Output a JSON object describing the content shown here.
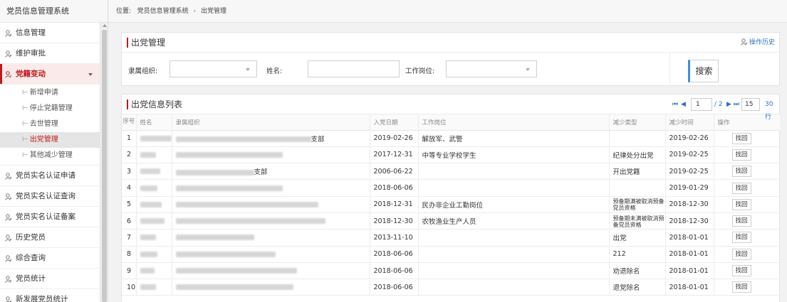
{
  "app": {
    "title": "党员信息管理系统"
  },
  "breadcrumb": {
    "label": "位置:",
    "path": [
      "党员信息管理系统",
      "出党管理"
    ],
    "separator": "›"
  },
  "sidebar": {
    "items": [
      {
        "label": "信息管理",
        "icon": "user-icon"
      },
      {
        "label": "维护审批",
        "icon": "user-icon"
      },
      {
        "label": "党籍变动",
        "icon": "user-icon",
        "active": true,
        "children": [
          {
            "label": "新增申请"
          },
          {
            "label": "停止党籍管理"
          },
          {
            "label": "去世管理"
          },
          {
            "label": "出党管理",
            "selected": true
          },
          {
            "label": "其他减少管理"
          }
        ]
      },
      {
        "label": "党员实名认证申请",
        "icon": "user-icon"
      },
      {
        "label": "党员实名认证查询",
        "icon": "user-icon"
      },
      {
        "label": "党员实名认证备案",
        "icon": "user-icon"
      },
      {
        "label": "历史党员",
        "icon": "user-icon"
      },
      {
        "label": "综合查询",
        "icon": "user-icon"
      },
      {
        "label": "党员统计",
        "icon": "user-icon"
      },
      {
        "label": "新发展党员统计",
        "icon": "user-icon"
      }
    ]
  },
  "filter_panel": {
    "title": "出党管理",
    "history_link": "操作历史",
    "org_label": "隶属组织:",
    "name_label": "姓名:",
    "post_label": "工作岗位:",
    "org_value": "",
    "name_value": "",
    "post_value": "",
    "search_button": "搜索"
  },
  "list_panel": {
    "title": "出党信息列表",
    "pager": {
      "first": "⏮",
      "prev": "◀",
      "current": "1",
      "total": "/ 2",
      "next": "▶",
      "last": "⏭",
      "page_size": "15",
      "count": "30行"
    },
    "columns": [
      "序号",
      "姓名",
      "隶属组织",
      "入党日期",
      "工作岗位",
      "减少类型",
      "减少时间",
      "操作"
    ],
    "rows": [
      {
        "no": "1",
        "org_suffix": "支部",
        "join": "2019-02-26",
        "post": "解放军、武警",
        "type": "",
        "date": "2019-02-26",
        "action": "找回"
      },
      {
        "no": "2",
        "org_suffix": "",
        "join": "2017-12-31",
        "post": "中等专业学校学生",
        "type": "纪律处分出党",
        "date": "2019-02-25",
        "action": "找回"
      },
      {
        "no": "3",
        "org_suffix": "支部",
        "join": "2006-06-22",
        "post": "",
        "type": "开出党籍",
        "date": "2019-02-25",
        "action": "找回"
      },
      {
        "no": "4",
        "org_suffix": "",
        "join": "2018-06-06",
        "post": "",
        "type": "",
        "date": "2019-01-29",
        "action": "找回"
      },
      {
        "no": "5",
        "org_suffix": "",
        "join": "2018-12-31",
        "post": "民办非企业工勤岗位",
        "type": "预备期满被取消预备党员资格",
        "date": "2018-12-30",
        "action": "找回"
      },
      {
        "no": "6",
        "org_suffix": "",
        "join": "2018-12-30",
        "post": "农牧渔业生产人员",
        "type": "预备期未满被取消预备党员资格",
        "date": "2018-12-30",
        "action": "找回"
      },
      {
        "no": "7",
        "org_suffix": "",
        "join": "2013-11-10",
        "post": "",
        "type": "出党",
        "date": "2018-01-01",
        "action": "找回"
      },
      {
        "no": "8",
        "org_suffix": "",
        "join": "2018-06-06",
        "post": "",
        "type": "212",
        "date": "2018-01-01",
        "action": "找回"
      },
      {
        "no": "9",
        "org_suffix": "",
        "join": "2018-06-06",
        "post": "",
        "type": "劝退除名",
        "date": "2018-01-01",
        "action": "找回"
      },
      {
        "no": "10",
        "org_suffix": "",
        "join": "2018-06-06",
        "post": "",
        "type": "退党除名",
        "date": "2018-01-01",
        "action": "找回"
      }
    ]
  },
  "colors": {
    "accent": "#c0191b",
    "link": "#2f6fc4",
    "search_accent": "#3c8dd8"
  }
}
